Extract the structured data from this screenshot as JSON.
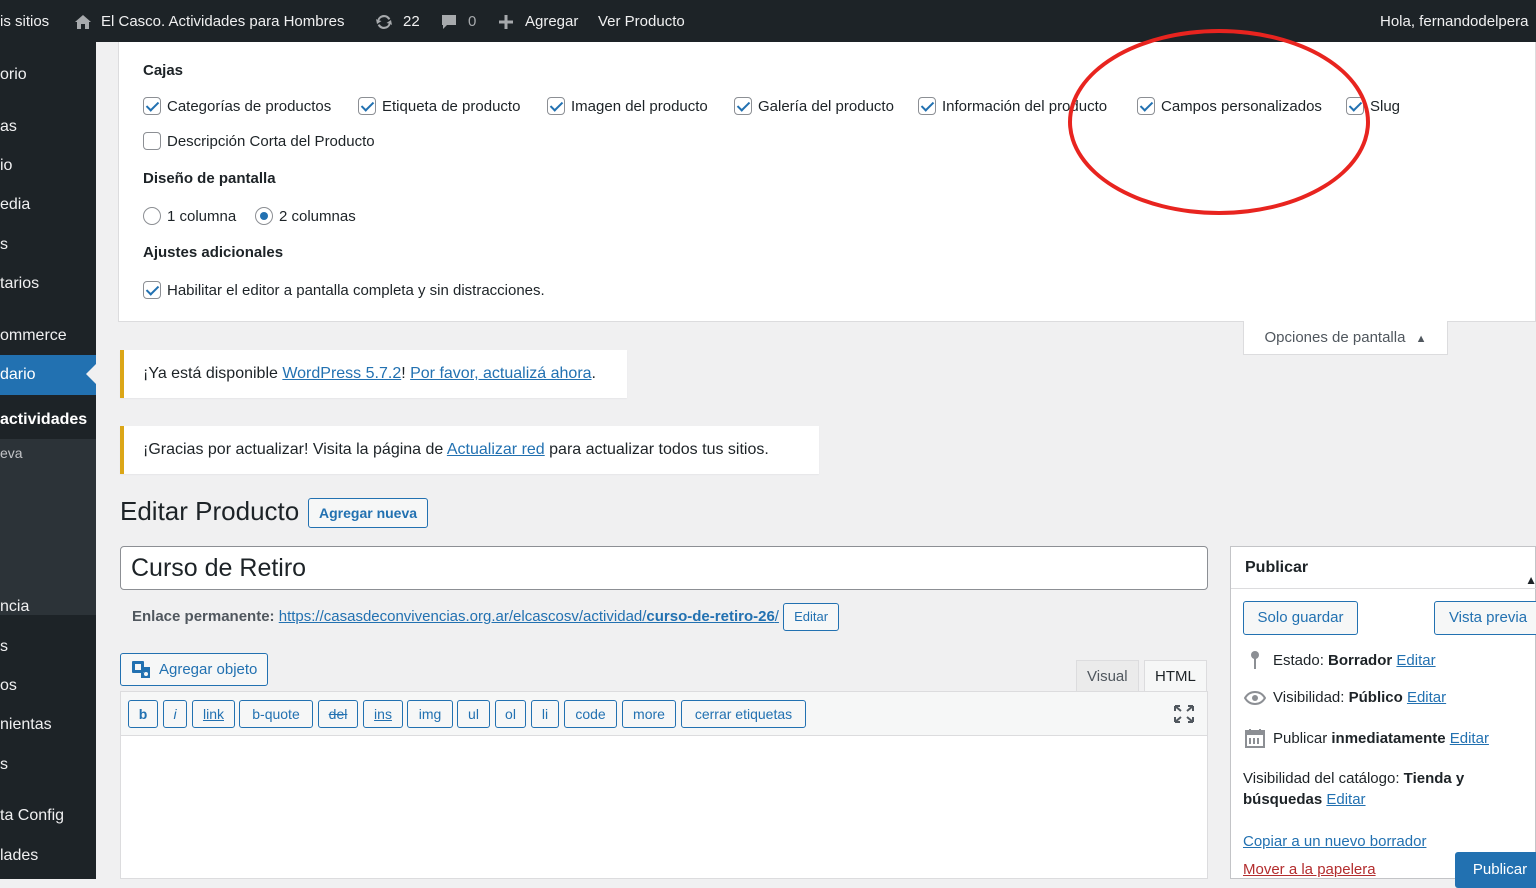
{
  "adminbar": {
    "my_sites": "is sitios",
    "site_name": "El Casco. Actividades para Hombres",
    "updates_count": "22",
    "comments_count": "0",
    "add_new": "Agregar",
    "view_product": "Ver Producto",
    "greeting": "Hola, fernandodelpera"
  },
  "sidebar": {
    "items": [
      "orio",
      "as",
      "io",
      "edia",
      "s",
      "tarios",
      "ommerce",
      "dario",
      "actividades",
      "eva",
      "ncia",
      "s",
      "os",
      "nientas",
      "s",
      "ta Config",
      "lades"
    ]
  },
  "screen_options": {
    "boxes_heading": "Cajas",
    "boxes": [
      {
        "label": "Categorías de productos",
        "checked": true
      },
      {
        "label": "Etiqueta de producto",
        "checked": true
      },
      {
        "label": "Imagen del producto",
        "checked": true
      },
      {
        "label": "Galería del producto",
        "checked": true
      },
      {
        "label": "Información del producto",
        "checked": true
      },
      {
        "label": "Campos personalizados",
        "checked": true
      },
      {
        "label": "Slug",
        "checked": true
      },
      {
        "label": "Descripción Corta del Producto",
        "checked": false
      }
    ],
    "layout_heading": "Diseño de pantalla",
    "layout_options": [
      "1 columna",
      "2 columnas"
    ],
    "layout_selected": "2 columnas",
    "extra_heading": "Ajustes adicionales",
    "extra_option": "Habilitar el editor a pantalla completa y sin distracciones.",
    "tab_label": "Opciones de pantalla"
  },
  "notices": {
    "update": {
      "prefix": "¡Ya está disponible ",
      "link1": "WordPress 5.7.2",
      "middle": "! ",
      "link2": "Por favor, actualizá ahora",
      "suffix": "."
    },
    "thanks": {
      "prefix": "¡Gracias por actualizar! Visita la página de ",
      "link": "Actualizar red",
      "suffix": " para actualizar todos tus sitios."
    }
  },
  "page": {
    "title": "Editar Producto",
    "add_new": "Agregar nueva",
    "post_title": "Curso de Retiro",
    "permalink_label": "Enlace permanente:",
    "permalink_base": "https://casasdeconvivencias.org.ar/elcascosv/actividad/",
    "permalink_slug": "curso-de-retiro-26",
    "permalink_end": "/",
    "permalink_edit": "Editar",
    "add_media": "Agregar objeto"
  },
  "editor": {
    "tab_visual": "Visual",
    "tab_html": "HTML",
    "quicktags": [
      "b",
      "i",
      "link",
      "b-quote",
      "del",
      "ins",
      "img",
      "ul",
      "ol",
      "li",
      "code",
      "more",
      "cerrar etiquetas"
    ]
  },
  "publish": {
    "title": "Publicar",
    "save_draft": "Solo guardar",
    "preview": "Vista previa",
    "status_label": "Estado:",
    "status_value": "Borrador",
    "visibility_label": "Visibilidad:",
    "visibility_value": "Público",
    "publish_label": "Publicar",
    "publish_value": "inmediatamente",
    "edit": "Editar",
    "catalog_label": "Visibilidad del catálogo:",
    "catalog_value1": "Tienda y",
    "catalog_value2": "búsquedas",
    "copy_draft": "Copiar a un nuevo borrador",
    "trash": "Mover a la papelera",
    "publish_button": "Publicar"
  },
  "colors": {
    "adminbar": "#1d2327",
    "accent": "#2271b1",
    "annotation": "#e8241f",
    "notice_warning": "#dba617"
  }
}
